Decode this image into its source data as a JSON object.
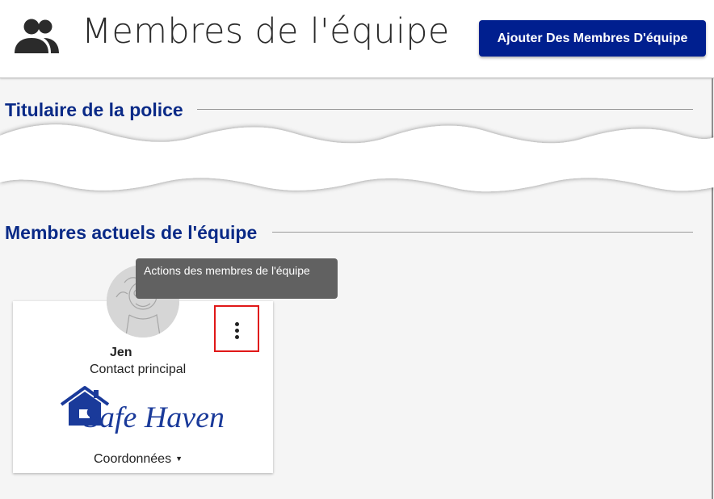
{
  "header": {
    "icon": "people-icon",
    "title": "Membres de l'équipe",
    "add_button_label": "Ajouter Des Membres D'équipe"
  },
  "sections": {
    "policy_holder_title": "Titulaire de la police",
    "current_members_title": "Membres actuels de l'équipe"
  },
  "tooltip": {
    "text": "Actions des membres de l'équipe"
  },
  "member": {
    "name": "Jen",
    "role": "Contact principal",
    "company_logo_text": "Safe Haven",
    "contact_toggle_label": "Coordonnées",
    "menu_icon": "more-vertical-icon"
  },
  "colors": {
    "brand_blue": "#001f8f",
    "section_title_blue": "#0a2a87",
    "highlight_red": "#e01818",
    "tooltip_bg": "#616161"
  }
}
